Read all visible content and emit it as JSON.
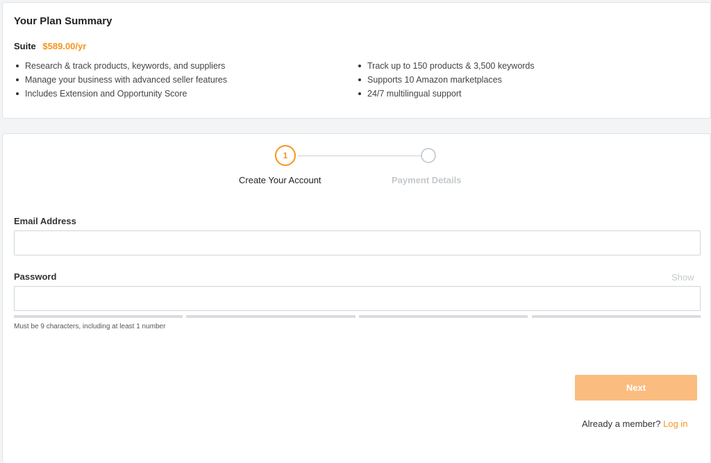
{
  "plan": {
    "title": "Your Plan Summary",
    "name": "Suite",
    "price": "$589.00/yr",
    "features_left": [
      "Research & track products, keywords, and suppliers",
      "Manage your business with advanced seller features",
      "Includes Extension and Opportunity Score"
    ],
    "features_right": [
      "Track up to 150 products & 3,500 keywords",
      "Supports 10 Amazon marketplaces",
      "24/7 multilingual support"
    ]
  },
  "stepper": {
    "step1_number": "1",
    "step1_label": "Create Your Account",
    "step2_label": "Payment Details",
    "active_step": 1
  },
  "form": {
    "email_label": "Email Address",
    "email_value": "",
    "password_label": "Password",
    "password_value": "",
    "show_label": "Show",
    "password_hint": "Must be 9 characters, including at least 1 number",
    "password_strength_filled": 0,
    "next_label": "Next",
    "member_text": "Already a member?",
    "login_label": "Log in"
  },
  "colors": {
    "accent": "#f7941d",
    "button_disabled": "#fbbc7f",
    "muted": "#c4c9cd"
  }
}
